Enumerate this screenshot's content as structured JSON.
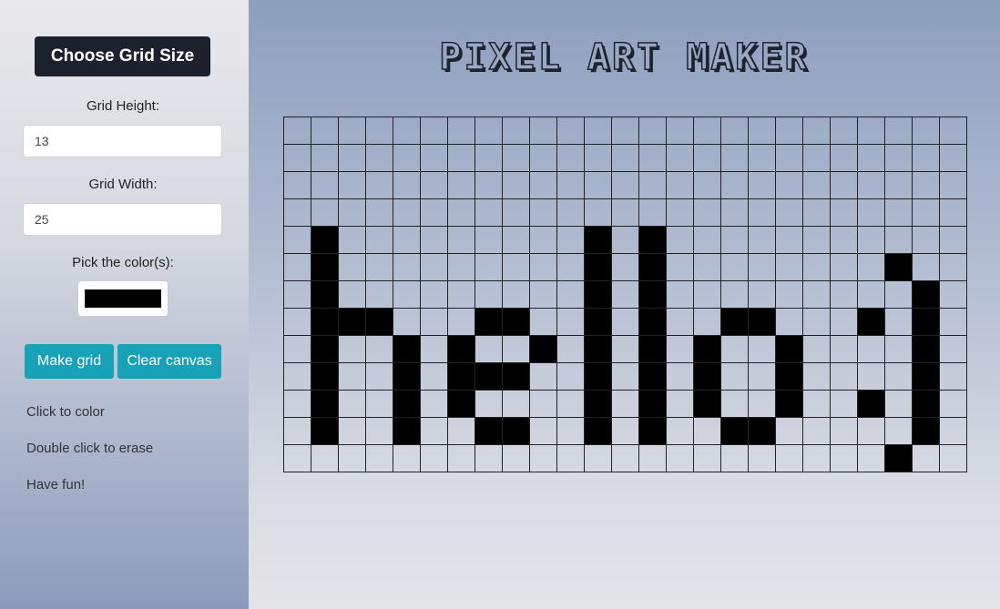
{
  "sidebar": {
    "choose_label": "Choose Grid Size",
    "height_label": "Grid Height:",
    "height_value": "13",
    "width_label": "Grid Width:",
    "width_value": "25",
    "color_label": "Pick the color(s):",
    "color_value": "#000000",
    "make_grid_label": "Make grid",
    "clear_label": "Clear canvas",
    "hints": [
      "Click to color",
      "Double click to erase",
      "Have fun!"
    ]
  },
  "main": {
    "title": "PIXEL ART MAKER"
  },
  "grid": {
    "rows": 13,
    "cols": 25,
    "filled_color": "#000000",
    "pixels": [
      "0000000000000000000000000",
      "0000000000000000000000000",
      "0000000000000000000000000",
      "0000000000000000000000000",
      "0100000000010100000000000",
      "0100000000010100000000100",
      "0100000000010100000000010",
      "0111000110010100110001010",
      "0100101001010101001000010",
      "0100101110010101001000010",
      "0100101000010101001001010",
      "0100100110010100110000010",
      "0000000000000000000000100"
    ]
  }
}
